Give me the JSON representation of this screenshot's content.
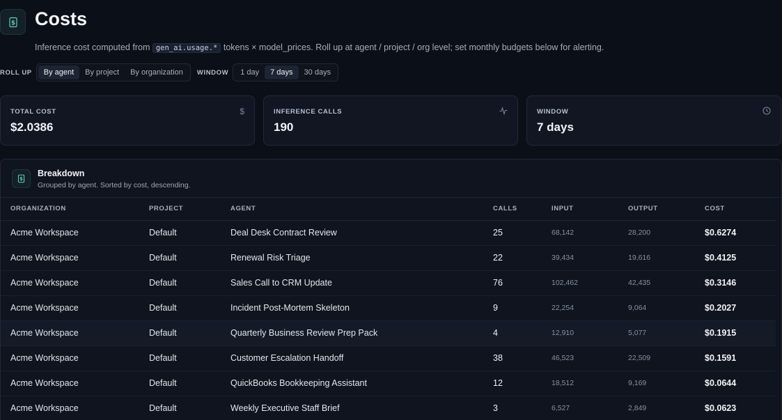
{
  "header": {
    "title": "Costs",
    "subtitle_prefix": "Inference cost computed from",
    "subtitle_code": "gen_ai.usage.*",
    "subtitle_suffix": "tokens × model_prices. Roll up at agent / project / org level; set monthly budgets below for alerting.",
    "icon": "dollar-document-icon"
  },
  "toolbar": {
    "rollup_label": "ROLL UP",
    "rollup_options": [
      "By agent",
      "By project",
      "By organization"
    ],
    "rollup_selected": "By agent",
    "window_label": "WINDOW",
    "window_options": [
      "1 day",
      "7 days",
      "30 days"
    ],
    "window_selected": "7 days"
  },
  "stats": [
    {
      "label": "TOTAL COST",
      "value": "$2.0386",
      "icon": "dollar-icon"
    },
    {
      "label": "INFERENCE CALLS",
      "value": "190",
      "icon": "activity-icon"
    },
    {
      "label": "WINDOW",
      "value": "7 days",
      "icon": "clock-icon"
    }
  ],
  "breakdown": {
    "title": "Breakdown",
    "subtitle": "Grouped by agent. Sorted by cost, descending.",
    "icon": "dollar-document-icon",
    "columns": [
      "ORGANIZATION",
      "PROJECT",
      "AGENT",
      "CALLS",
      "INPUT",
      "OUTPUT",
      "COST"
    ],
    "rows": [
      {
        "organization": "Acme Workspace",
        "project": "Default",
        "agent": "Deal Desk Contract Review",
        "calls": "25",
        "input": "68,142",
        "output": "28,200",
        "cost": "$0.6274"
      },
      {
        "organization": "Acme Workspace",
        "project": "Default",
        "agent": "Renewal Risk Triage",
        "calls": "22",
        "input": "39,434",
        "output": "19,616",
        "cost": "$0.4125"
      },
      {
        "organization": "Acme Workspace",
        "project": "Default",
        "agent": "Sales Call to CRM Update",
        "calls": "76",
        "input": "102,462",
        "output": "42,435",
        "cost": "$0.3146"
      },
      {
        "organization": "Acme Workspace",
        "project": "Default",
        "agent": "Incident Post-Mortem Skeleton",
        "calls": "9",
        "input": "22,254",
        "output": "9,064",
        "cost": "$0.2027"
      },
      {
        "organization": "Acme Workspace",
        "project": "Default",
        "agent": "Quarterly Business Review Prep Pack",
        "calls": "4",
        "input": "12,910",
        "output": "5,077",
        "cost": "$0.1915"
      },
      {
        "organization": "Acme Workspace",
        "project": "Default",
        "agent": "Customer Escalation Handoff",
        "calls": "38",
        "input": "46,523",
        "output": "22,509",
        "cost": "$0.1591"
      },
      {
        "organization": "Acme Workspace",
        "project": "Default",
        "agent": "QuickBooks Bookkeeping Assistant",
        "calls": "12",
        "input": "18,512",
        "output": "9,169",
        "cost": "$0.0644"
      },
      {
        "organization": "Acme Workspace",
        "project": "Default",
        "agent": "Weekly Executive Staff Brief",
        "calls": "3",
        "input": "6,527",
        "output": "2,849",
        "cost": "$0.0623"
      }
    ]
  }
}
